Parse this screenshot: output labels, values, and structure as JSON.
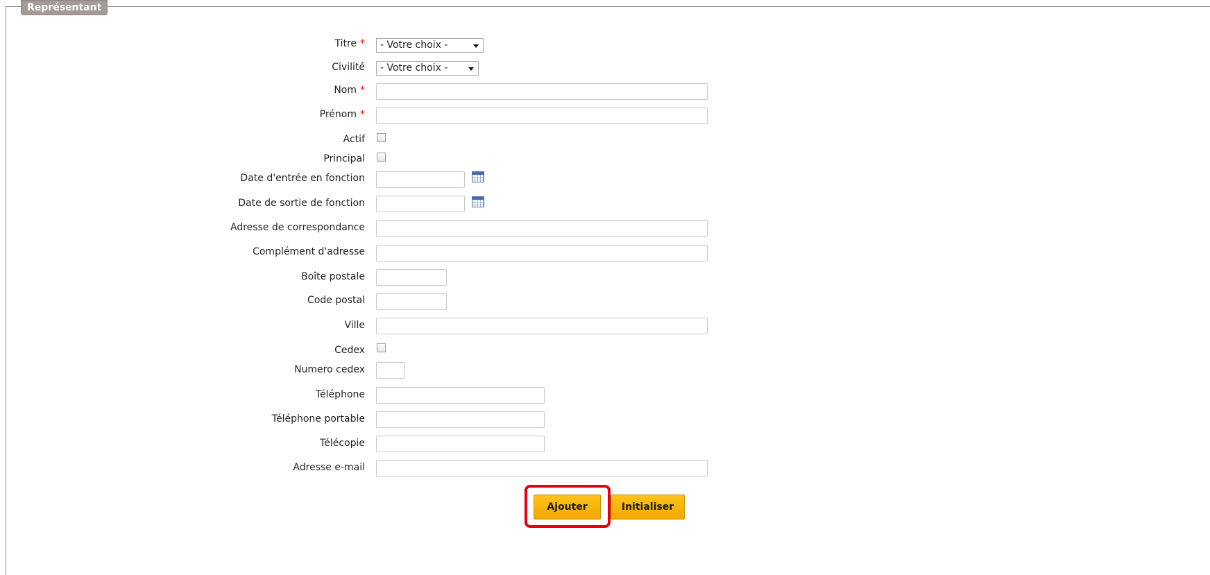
{
  "fieldset": {
    "legend": "Représentant"
  },
  "form": {
    "required_marker": "*",
    "titre": {
      "label": "Titre",
      "value": "- Votre choix -"
    },
    "civilite": {
      "label": "Civilité",
      "value": "- Votre choix -"
    },
    "nom": {
      "label": "Nom",
      "value": ""
    },
    "prenom": {
      "label": "Prénom",
      "value": ""
    },
    "actif": {
      "label": "Actif",
      "checked": false
    },
    "principal": {
      "label": "Principal",
      "checked": false
    },
    "date_entree": {
      "label": "Date d'entrée en fonction",
      "value": ""
    },
    "date_sortie": {
      "label": "Date de sortie de fonction",
      "value": ""
    },
    "adresse": {
      "label": "Adresse de correspondance",
      "value": ""
    },
    "complement": {
      "label": "Complément d'adresse",
      "value": ""
    },
    "boite_postale": {
      "label": "Boîte postale",
      "value": ""
    },
    "code_postal": {
      "label": "Code postal",
      "value": ""
    },
    "ville": {
      "label": "Ville",
      "value": ""
    },
    "cedex": {
      "label": "Cedex",
      "checked": false
    },
    "numero_cedex": {
      "label": "Numero cedex",
      "value": ""
    },
    "telephone": {
      "label": "Téléphone",
      "value": ""
    },
    "telephone_portable": {
      "label": "Téléphone portable",
      "value": ""
    },
    "telecopie": {
      "label": "Télécopie",
      "value": ""
    },
    "email": {
      "label": "Adresse e-mail",
      "value": ""
    }
  },
  "actions": {
    "add_label": "Ajouter",
    "reset_label": "Initialiser"
  },
  "icons": {
    "calendar": "calendar-icon",
    "dropdown": "chevron-down-icon"
  },
  "colors": {
    "legend_bg": "#a49a96",
    "button_bg": "#f5b300",
    "required": "#e11b1b",
    "highlight": "#e3000f"
  }
}
